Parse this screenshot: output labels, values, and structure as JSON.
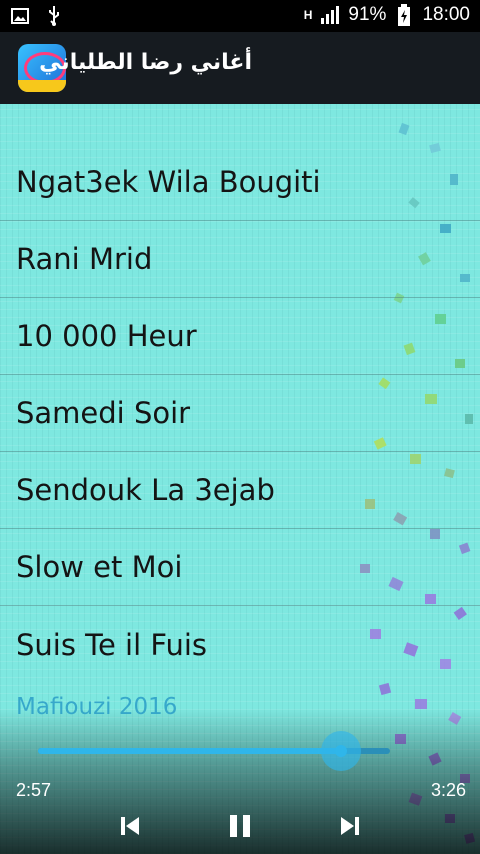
{
  "status_bar": {
    "network": "H",
    "battery_percent": "91%",
    "time": "18:00",
    "icons": [
      "image-notification-icon",
      "usb-icon",
      "network-type-icon",
      "signal-icon",
      "battery-charging-icon"
    ]
  },
  "app_bar": {
    "title": "أغاني رضا الطلياني",
    "icon": "app-logo"
  },
  "songs": [
    {
      "title": "Ngat3ek Wila Bougiti"
    },
    {
      "title": "Rani Mrid"
    },
    {
      "title": "10 000 Heur"
    },
    {
      "title": "Samedi Soir"
    },
    {
      "title": "Sendouk La 3ejab"
    },
    {
      "title": "Slow et Moi"
    },
    {
      "title": "Suis Te il Fuis"
    }
  ],
  "player": {
    "album": "Mafiouzi 2016",
    "elapsed": "2:57",
    "total": "3:26",
    "progress": 0.86,
    "controls": [
      "previous-icon",
      "pause-icon",
      "next-icon"
    ]
  },
  "colors": {
    "background": "#7ee8e0",
    "app_bar": "#161b20",
    "accent": "#2fb6ea",
    "text": "#141414"
  }
}
